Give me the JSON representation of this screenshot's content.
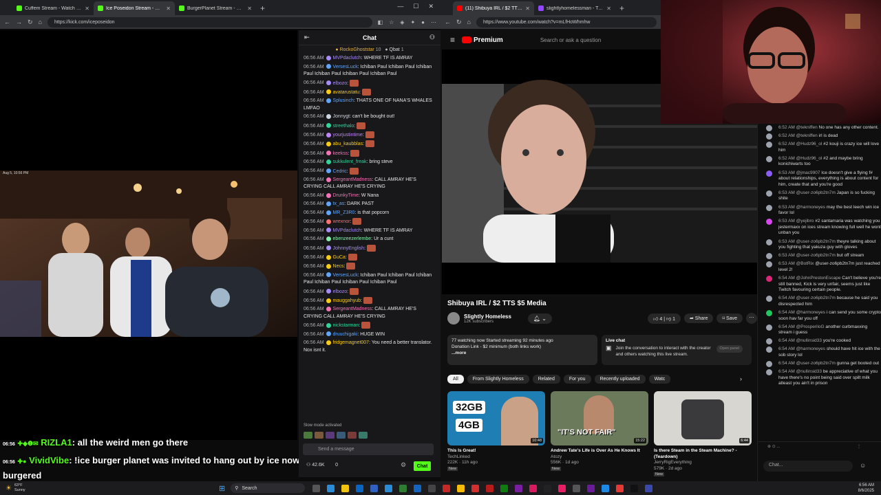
{
  "left_browser": {
    "tabs": [
      {
        "label": "Cuffem Stream - Watch Live on Ki",
        "active": false,
        "color": "#53fc18"
      },
      {
        "label": "Ice Poseidon Stream - Watch",
        "active": true,
        "color": "#53fc18"
      },
      {
        "label": "BurgerPlanet Stream - Watch",
        "active": false,
        "color": "#53fc18"
      }
    ],
    "url": "https://kick.com/iceposeidon",
    "video_timestamp": "Aug 5, 10:56 PM",
    "overlay_lines": [
      {
        "time": "06:56",
        "user": "RIZLA1",
        "text": ": all the weird men go there",
        "color": "#53fc18"
      },
      {
        "time": "06:56",
        "user": "VividVibe",
        "text": ": !ice burger planet was invited to hang out by ice now he also got burgered",
        "color": "#53fc18"
      }
    ],
    "chat": {
      "title": "Chat",
      "pinned": [
        {
          "user": "RockoGhoststar",
          "count": "10"
        },
        {
          "user": "Qbat",
          "count": "1"
        }
      ],
      "messages": [
        {
          "time": "06:56 AM",
          "user": "MVPdaclutch",
          "color": "#a78bfa",
          "text": ": WHERE TF IS AMRAY"
        },
        {
          "time": "06:56 AM",
          "user": "VersesLuck",
          "color": "#60a5fa",
          "text": ": Ichiban Paul Ichiban Paul Ichiban Paul Ichiban Paul Ichiban Paul Ichiban Paul"
        },
        {
          "time": "06:56 AM",
          "user": "elbozo",
          "color": "#a78bfa",
          "text": ":",
          "emote": true
        },
        {
          "time": "06:56 AM",
          "user": "avatarustatu",
          "color": "#facc15",
          "text": ":",
          "emote": true
        },
        {
          "time": "06:56 AM",
          "user": "Splusinch",
          "color": "#60a5fa",
          "text": ": THATS ONE OF NANA'S WHALES LMFAO"
        },
        {
          "time": "06:56 AM",
          "user": "Jonnygt",
          "color": "#cbd5e1",
          "text": ": can't be bought out!"
        },
        {
          "time": "06:56 AM",
          "user": "streethalo",
          "color": "#34d399",
          "text": ":",
          "emote": true
        },
        {
          "time": "06:56 AM",
          "user": "yourjustintime",
          "color": "#c084fc",
          "text": ":",
          "emote": true
        },
        {
          "time": "06:56 AM",
          "user": "abu_kaubblas",
          "color": "#facc15",
          "text": ":",
          "emote": true
        },
        {
          "time": "06:56 AM",
          "user": "keekss",
          "color": "#f472b6",
          "text": ":",
          "emote": true
        },
        {
          "time": "06:56 AM",
          "user": "sukkulent_freak",
          "color": "#34d399",
          "text": ": bring steve"
        },
        {
          "time": "06:56 AM",
          "user": "Cedric",
          "color": "#60a5fa",
          "text": ":",
          "emote": true
        },
        {
          "time": "06:56 AM",
          "user": "SergeantMadness",
          "color": "#f472b6",
          "text": ": CALL AMRAY HE'S CRYING CALL AMRAY HE'S CRYING"
        },
        {
          "time": "06:56 AM",
          "user": "DrunkyTime",
          "color": "#f472b6",
          "text": ": W Nana"
        },
        {
          "time": "06:56 AM",
          "user": "tx_as",
          "color": "#60a5fa",
          "text": ": DARK PAST"
        },
        {
          "time": "06:56 AM",
          "user": "MR_Z3R0",
          "color": "#60a5fa",
          "text": ": is that popcorn"
        },
        {
          "time": "06:56 AM",
          "user": "wrexnor",
          "color": "#f87171",
          "text": ":",
          "emote": true
        },
        {
          "time": "06:56 AM",
          "user": "MVPdaclutch",
          "color": "#a78bfa",
          "text": ": WHERE TF IS AMRAY"
        },
        {
          "time": "06:56 AM",
          "user": "ebenzeezerlembe",
          "color": "#86efac",
          "text": ": Ur a cunt"
        },
        {
          "time": "06:56 AM",
          "user": "JohnnyEnglish",
          "color": "#a78bfa",
          "text": ":",
          "emote": true
        },
        {
          "time": "06:56 AM",
          "user": "GuCa",
          "color": "#facc15",
          "text": ":",
          "emote": true
        },
        {
          "time": "06:56 AM",
          "user": "Necs",
          "color": "#facc15",
          "text": ":",
          "emote": true
        },
        {
          "time": "06:56 AM",
          "user": "VersesLuck",
          "color": "#60a5fa",
          "text": ": Ichiban Paul Ichiban Paul Ichiban Paul Ichiban Paul Ichiban Paul Ichiban Paul"
        },
        {
          "time": "06:56 AM",
          "user": "elbozo",
          "color": "#a78bfa",
          "text": ":",
          "emote": true
        },
        {
          "time": "06:56 AM",
          "user": "mauggahyub",
          "color": "#facc15",
          "text": ":",
          "emote": true
        },
        {
          "time": "06:56 AM",
          "user": "SergeantMadness",
          "color": "#f472b6",
          "text": ": CALL AMRAY HE'S CRYING CALL AMRAY HE'S CRYING"
        },
        {
          "time": "06:56 AM",
          "user": "nickstarman",
          "color": "#34d399",
          "text": ":",
          "emote": true
        },
        {
          "time": "06:56 AM",
          "user": "druuchigaki",
          "color": "#60a5fa",
          "text": ": HUGE WIN"
        },
        {
          "time": "06:56 AM",
          "user": "fridgemagnet007",
          "color": "#facc15",
          "text": ": You need a better translator. Nox isnt it."
        }
      ],
      "slow_mode": "Slow mode activated",
      "input_placeholder": "Send a message",
      "viewers": "42.6K",
      "viewers_second": "0",
      "send_label": "Chat"
    }
  },
  "right_browser": {
    "tabs": [
      {
        "label": "(11) Shibuya IRL / $2 TTS $5 M",
        "active": true,
        "color": "#ff0000"
      },
      {
        "label": "slightlyhomelessman - Twitch",
        "active": false,
        "color": "#9146ff"
      }
    ],
    "url": "https://www.youtube.com/watch?v=mLfHoWhmhw",
    "brand": "Premium",
    "search_placeholder": "Search or ask a question",
    "video_title": "Shibuya IRL / $2 TTS $5 Media",
    "channel": "Slightly Homeless",
    "subscribers": "12K subscribers",
    "likes": "4",
    "dislikes": "1",
    "share_label": "Share",
    "save_label": "Save",
    "description": "77 watching now  Started streaming 92 minutes ago",
    "description_line2": "Donation Link - $2 minimum (both links work)",
    "more_label": "...more",
    "live_chat_title": "Live chat",
    "live_chat_text": "Join the conversation to interact with the creator and others watching this live stream.",
    "open_panel_label": "Open panel",
    "chips": [
      "All",
      "From Slightly Homeless",
      "Related",
      "For you",
      "Recently uploaded",
      "Watc"
    ],
    "videos": [
      {
        "title": "This Is Great!",
        "channel": "TechLinked",
        "meta": "222K · 11h ago",
        "badge": "New",
        "duration": "10:48",
        "thumb_text_top": "32GB",
        "thumb_text_bottom": "4GB"
      },
      {
        "title": "Andrew Tate's Life is Over As He Knows It",
        "channel": "Atozy",
        "meta": "556K · 1d ago",
        "badge": "New",
        "duration": "15:22",
        "thumb_text": "\"IT'S NOT FAIR\""
      },
      {
        "title": "Is there Steam in the Steam Machine? - (Teardown)",
        "channel": "JerryRigEverything",
        "meta": "579K · 2d ago",
        "badge": "New",
        "duration": "6:44"
      }
    ]
  },
  "side_chat": {
    "messages": [
      {
        "time": "6:52 AM",
        "user": "@tekniffen",
        "text": "No one has any other content.",
        "color": "#9ca3af"
      },
      {
        "time": "6:52 AM",
        "user": "@tekniffen",
        "text": "irl is dead",
        "color": "#9ca3af"
      },
      {
        "time": "6:52 AM",
        "user": "@Hudz96_ol",
        "text": "#2  kouji is crazy ice will love him",
        "color": "#9ca3af"
      },
      {
        "time": "6:52 AM",
        "user": "@Hudz96_ol",
        "text": "#2  and maybe bring konichiwarts too",
        "color": "#9ca3af"
      },
      {
        "time": "6:53 AM",
        "user": "@jmac9907",
        "text": "Ice doesn't give a flying f# about relationships, everything is about content for him, create that and you're good",
        "color": "#8b5cf6"
      },
      {
        "time": "6:53 AM",
        "user": "@user-zo6pb2tn7m",
        "text": "Japan is so fucking shite",
        "color": "#9ca3af"
      },
      {
        "time": "6:53 AM",
        "user": "@harmoneyes",
        "text": "may the best leech win ice favor lol",
        "color": "#9ca3af"
      },
      {
        "time": "6:53 AM",
        "user": "@yejibro",
        "text": "#2  santamaria was watching you jestermaxx on ices stream knowing full well he wont unban you",
        "color": "#d946ef"
      },
      {
        "time": "6:53 AM",
        "user": "@user-zo6pb2tn7m",
        "text": "theyre talking about you fighting that yakuza guy with gloves",
        "color": "#9ca3af"
      },
      {
        "time": "6:53 AM",
        "user": "@user-zo6pb2tn7m",
        "text": "but off stream",
        "color": "#9ca3af"
      },
      {
        "time": "6:53 AM",
        "user": "@BotRix",
        "text": "@user-zo6pb2tn7m just reached level 2!",
        "color": "#9ca3af"
      },
      {
        "time": "6:54 AM",
        "user": "@JohnPrestonEscape",
        "text": "Can't believe you're still banned, Kick is very unfair, seems just like Twitch favouring certain people.",
        "color": "#db2777"
      },
      {
        "time": "6:54 AM",
        "user": "@user-zo6pb2tn7m",
        "text": "because he said you disrespected him",
        "color": "#9ca3af"
      },
      {
        "time": "6:54 AM",
        "user": "@harmoneyes",
        "text": "i can send you some crypto soon hav far you off",
        "color": "#22c55e"
      },
      {
        "time": "6:54 AM",
        "user": "@ProsperiloG",
        "text": "another curbmaxxing stream i guess",
        "color": "#9ca3af"
      },
      {
        "time": "6:54 AM",
        "user": "@nullinsid33",
        "text": "you're cooked",
        "color": "#9ca3af"
      },
      {
        "time": "6:54 AM",
        "user": "@harmoneyes",
        "text": "should have hit ice with the sob story lol",
        "color": "#9ca3af"
      },
      {
        "time": "6:54 AM",
        "user": "@user-zo6pb2tn7m",
        "text": "gunna get booted out",
        "color": "#9ca3af"
      },
      {
        "time": "6:54 AM",
        "user": "@nullinsid33",
        "text": "be appreciative of what you have there's no point being said over spilt milk atleast you ain't in prison",
        "color": "#9ca3af"
      }
    ],
    "input_placeholder": "Chat..."
  },
  "taskbar": {
    "weather_temp": "63°F",
    "weather_desc": "Sunny",
    "search_label": "Search",
    "clock_time": "6:56 AM",
    "clock_date": "8/6/2025"
  }
}
